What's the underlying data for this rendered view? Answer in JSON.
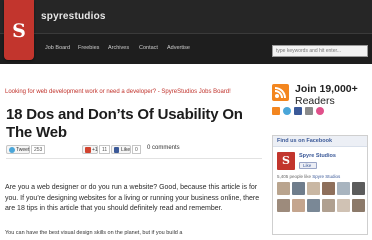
{
  "header": {
    "site_name": "spyrestudios",
    "logo_letter": "S",
    "nav": [
      "Job Board",
      "Freebies",
      "Archives",
      "Contact",
      "Advertise"
    ],
    "search_placeholder": "type keywords and hit enter..."
  },
  "article": {
    "promo_link": "Looking for web development work or need a developer? - SpyreStudios Jobs Board!",
    "title": "18 Dos and Don’ts Of Usability On The Web",
    "share": {
      "tweet_label": "Tweet",
      "tweet_count": "253",
      "gplus_label": "+1",
      "gplus_count": "11",
      "like_label": "Like",
      "like_count": "0",
      "comments": "0 comments"
    },
    "intro": "Are you a web designer or do you run a website? Good, because this article is for you. If you’re designing websites for a living or running your business online, there are 18 tips in this article that you should definitely read and remember.",
    "body_start": "You can have the best visual design skills on the planet, but if you build a"
  },
  "sidebar": {
    "join_line1": "Join 19,000+",
    "join_line2": "Readers",
    "social_icons": [
      "rss-icon",
      "twitter-icon",
      "facebook-icon",
      "email-icon",
      "dribbble-icon"
    ],
    "facebook_box": {
      "heading": "Find us on Facebook",
      "page_name": "Spyre Studios",
      "like_label": "Like",
      "stats_prefix": "5,405 people like",
      "stats_link": "Spyre Studios"
    }
  },
  "colors": {
    "brand_red": "#c2352d",
    "header_dark": "#262626",
    "rss_orange": "#f3861f",
    "facebook_blue": "#3b5998"
  }
}
